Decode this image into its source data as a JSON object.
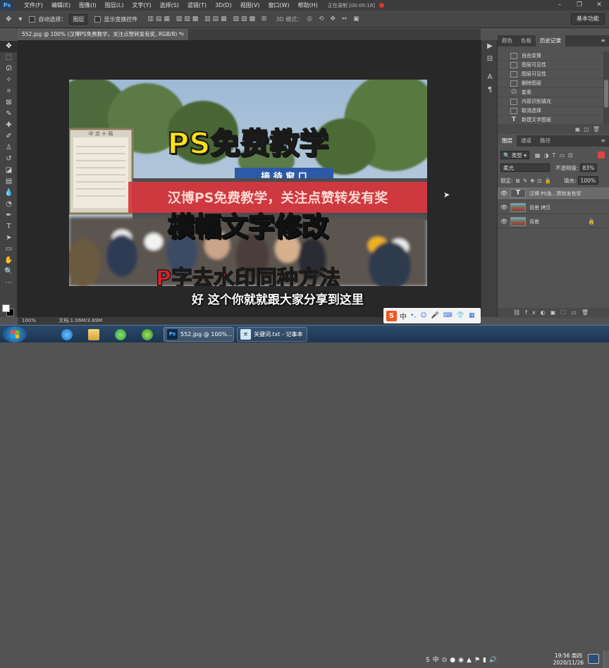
{
  "menubar": {
    "logo": "Ps",
    "items": [
      "文件(F)",
      "编辑(E)",
      "图像(I)",
      "图层(L)",
      "文字(Y)",
      "选择(S)",
      "滤镜(T)",
      "3D(D)",
      "视图(V)",
      "窗口(W)",
      "帮助(H)"
    ],
    "recording": "正在录制 [00:00:18]",
    "window_controls": [
      "–",
      "❐",
      "✕"
    ]
  },
  "optionsbar": {
    "auto_select_label": "自动选择：",
    "auto_select_value": "图层",
    "show_transform_label": "显示变换控件",
    "mode_3d_label": "3D 模式：",
    "workspace": "基本功能"
  },
  "document": {
    "tab_title": "552.jpg @ 100% (汉博PS免费教学，关注点赞转发有奖, RGB/8) *",
    "close": "×"
  },
  "canvas": {
    "banner_text": "汉博PS免费教学，关注点赞转发有奖",
    "sign_text": "接 待 窗 口",
    "board_text": "中 交 十 局",
    "overlay_title_1": "PS免费教学",
    "overlay_title_2": "横幅文字修改",
    "overlay_title_3": "P字去水印同种方法"
  },
  "subtitle": "好 这个你就就跟大家分享到这里",
  "statusbar": {
    "zoom": "100%",
    "doc_info": "文档:1.06M/3.89M"
  },
  "history_panel": {
    "tabs": [
      "颜色",
      "色板",
      "历史记录"
    ],
    "active_tab": 2,
    "items": [
      {
        "label": "自由变换",
        "icon": "doc"
      },
      {
        "label": "图层可见性",
        "icon": "doc"
      },
      {
        "label": "图层可见性",
        "icon": "doc"
      },
      {
        "label": "删除图层",
        "icon": "doc"
      },
      {
        "label": "套索",
        "icon": "lasso"
      },
      {
        "label": "内容识别填充",
        "icon": "doc"
      },
      {
        "label": "取消选择",
        "icon": "doc"
      },
      {
        "label": "新建文字图层",
        "icon": "text"
      }
    ]
  },
  "layers_panel": {
    "tabs": [
      "图层",
      "通道",
      "路径"
    ],
    "active_tab": 0,
    "filter_label": "类型",
    "blend_mode": "柔光",
    "opacity_label": "不透明度:",
    "opacity_value": "83%",
    "lock_label": "锁定:",
    "fill_label": "填充:",
    "fill_value": "100%",
    "layers": [
      {
        "name": "汉博 PS免...赞转发有奖",
        "kind": "text",
        "selected": true,
        "locked": false
      },
      {
        "name": "背景 拷贝",
        "kind": "image",
        "selected": false,
        "locked": false
      },
      {
        "name": "背景",
        "kind": "image",
        "selected": false,
        "locked": true
      }
    ]
  },
  "taskbar": {
    "tasks": [
      {
        "label": "552.jpg @ 100%...",
        "icon": "Ps"
      },
      {
        "label": "关键词.txt - 记事本",
        "icon": "≡"
      }
    ],
    "ime": {
      "brand": "S",
      "mode": "中"
    },
    "clock_time": "19:56 周四",
    "clock_date": "2020/11/26"
  },
  "colors": {
    "banner_red": "#d9363e",
    "title_yellow": "#ffe11a",
    "title_blue": "#1b6bff",
    "title_red": "#e4202a"
  }
}
